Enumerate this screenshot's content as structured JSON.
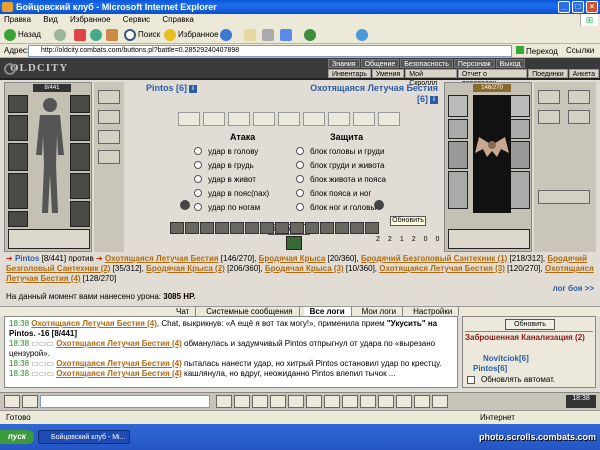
{
  "window": {
    "title": "Бойцовский клуб - Microsoft Internet Explorer"
  },
  "menu": [
    "Правка",
    "Вид",
    "Избранное",
    "Сервис",
    "Справка"
  ],
  "toolbar": {
    "back": "Назад",
    "search": "Поиск",
    "favorites": "Избранное"
  },
  "address": {
    "label": "Адрес:",
    "url": "http://oldcity.combats.com/buttons.pl?battle=0.28529240407898",
    "go": "Переход",
    "links": "Ссылки"
  },
  "game": {
    "logo": "OLDCITY",
    "top_nav": [
      "Знания",
      "Общение",
      "Безопасность",
      "Персонаж",
      "Выход"
    ],
    "sub_nav": [
      "Инвентарь",
      "Умения",
      "Мой Скроллл",
      "Отчет о переводах",
      "Поединки",
      "Анкета"
    ],
    "player": {
      "name": "Pintos [6]",
      "hp": "8/441"
    },
    "opponent": {
      "name": "Охотящаяся Летучая Бестия",
      "level": "[6]",
      "hp": "146/270"
    },
    "vs": "против",
    "attack": {
      "title": "Атака",
      "options": [
        "удар в голову",
        "удар в грудь",
        "удар в живот",
        "удар в пояс(пах)",
        "удар по ногам"
      ]
    },
    "defense": {
      "title": "Защита",
      "options": [
        "блок головы и груди",
        "блок груди и живота",
        "блок живота и пояса",
        "блок пояса и ног",
        "блок ног и головы"
      ]
    },
    "forward": "Вперёд!!!",
    "refresh": "Обновить",
    "stats": [
      "2",
      "2",
      "1",
      "2",
      "0",
      "0"
    ],
    "fight_line": {
      "player": "Pintos",
      "player_hp": "[8/441]",
      "vs": "против",
      "enemies": [
        {
          "name": "Охотящаяся Летучая Бестия",
          "hp": "[146/270]"
        },
        {
          "name": "Бродячая Крыса",
          "hp": "[20/360]"
        },
        {
          "name": "Бродячий Безголовый Сантехник (1)",
          "hp": "[218/312]"
        },
        {
          "name": "Бродячий Безголовый Сантехник (2)",
          "hp": "[35/312]"
        },
        {
          "name": "Бродячая Крыса (2)",
          "hp": "[206/360]"
        },
        {
          "name": "Бродячая Крыса (3)",
          "hp": "[10/360]"
        },
        {
          "name": "Охотящаяся Летучая Бестия (3)",
          "hp": "[120/270]"
        },
        {
          "name": "Охотящаяся Летучая Бестия (4)",
          "hp": "[128/270]"
        }
      ]
    },
    "bats_link": "лог боя >>",
    "damage": {
      "label": "На данный момент вами нанесено урона:",
      "value": "3085 HP."
    }
  },
  "tabs": [
    "Чат",
    "Системные сообщения",
    "Все логи",
    "Мои логи",
    "Настройки"
  ],
  "chat": [
    {
      "time": "18:38",
      "actor": "Охотящаяся Летучая Бестия (4)",
      "text": "Chat, выкрикнув: «А ещё я вот так могу!», применила прием",
      "tail": "\"Укусить\" на Pintos. -16 [8/441]"
    },
    {
      "time": "18:38",
      "actor": "Охотящаяся Летучая Бестия (4)",
      "text": "обманулась и задумчивый Pintos отпрыгнул от удара по «вырезано цензурой»."
    },
    {
      "time": "18:38",
      "actor": "Охотящаяся Летучая Бестия (4)",
      "text": "пыталась нанести удар, но хитрый Pintos остановил удар по крестцу."
    },
    {
      "time": "18:38",
      "actor": "Охотящаяся Летучая Бестия (4)",
      "text": "кашлянула, но вдруг, неожиданно Pintos влепил тычок ..."
    }
  ],
  "room": {
    "refresh": "Обновить",
    "name": "Заброшенная Канализация (2)",
    "users": [
      "Novitcіok[6]",
      "Pintos[6]"
    ],
    "auto": "Обновлять автомат."
  },
  "clock": "18:38",
  "status": {
    "text": "Готово",
    "zone": "Интернет"
  },
  "taskbar": {
    "start": "пуск",
    "task": "Бойцовский клуб - Mi...",
    "watermark": "photo.scrolls.combats.com"
  }
}
